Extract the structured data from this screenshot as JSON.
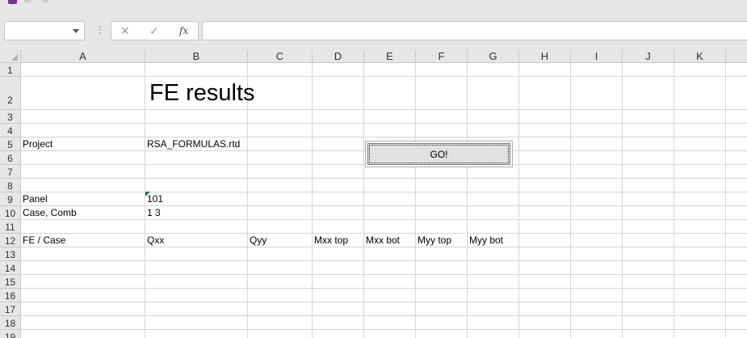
{
  "toolbar": {
    "icons": [
      "save-icon",
      "undo-icon",
      "redo-icon"
    ]
  },
  "formula_bar": {
    "name_box_value": "",
    "cancel_symbol": "✕",
    "enter_symbol": "✓",
    "fx_label": "fx",
    "formula_value": ""
  },
  "columns": [
    "A",
    "B",
    "C",
    "D",
    "E",
    "F",
    "G",
    "H",
    "I",
    "J",
    "K"
  ],
  "rows": [
    "1",
    "2",
    "3",
    "4",
    "5",
    "6",
    "7",
    "8",
    "9",
    "10",
    "11",
    "12",
    "13",
    "14",
    "15",
    "16",
    "17",
    "18",
    "19"
  ],
  "cells": {
    "B2": "FE results",
    "A5": "Project",
    "B5": "RSA_FORMULAS.rtd",
    "A9": "Panel",
    "B9": "101",
    "A10": "Case, Comb",
    "B10": "1 3",
    "A12": "FE / Case",
    "B12": "Qxx",
    "C12": "Qyy",
    "D12": "Mxx top",
    "E12": "Mxx bot",
    "F12": "Myy top",
    "G12": "Myy bot"
  },
  "go_button": {
    "label": "GO!"
  },
  "colors": {
    "chrome": "#e6e6e6",
    "gridline": "#d4d4d4",
    "comment_marker": "#1e7145",
    "save_icon": "#7b2f8e"
  }
}
